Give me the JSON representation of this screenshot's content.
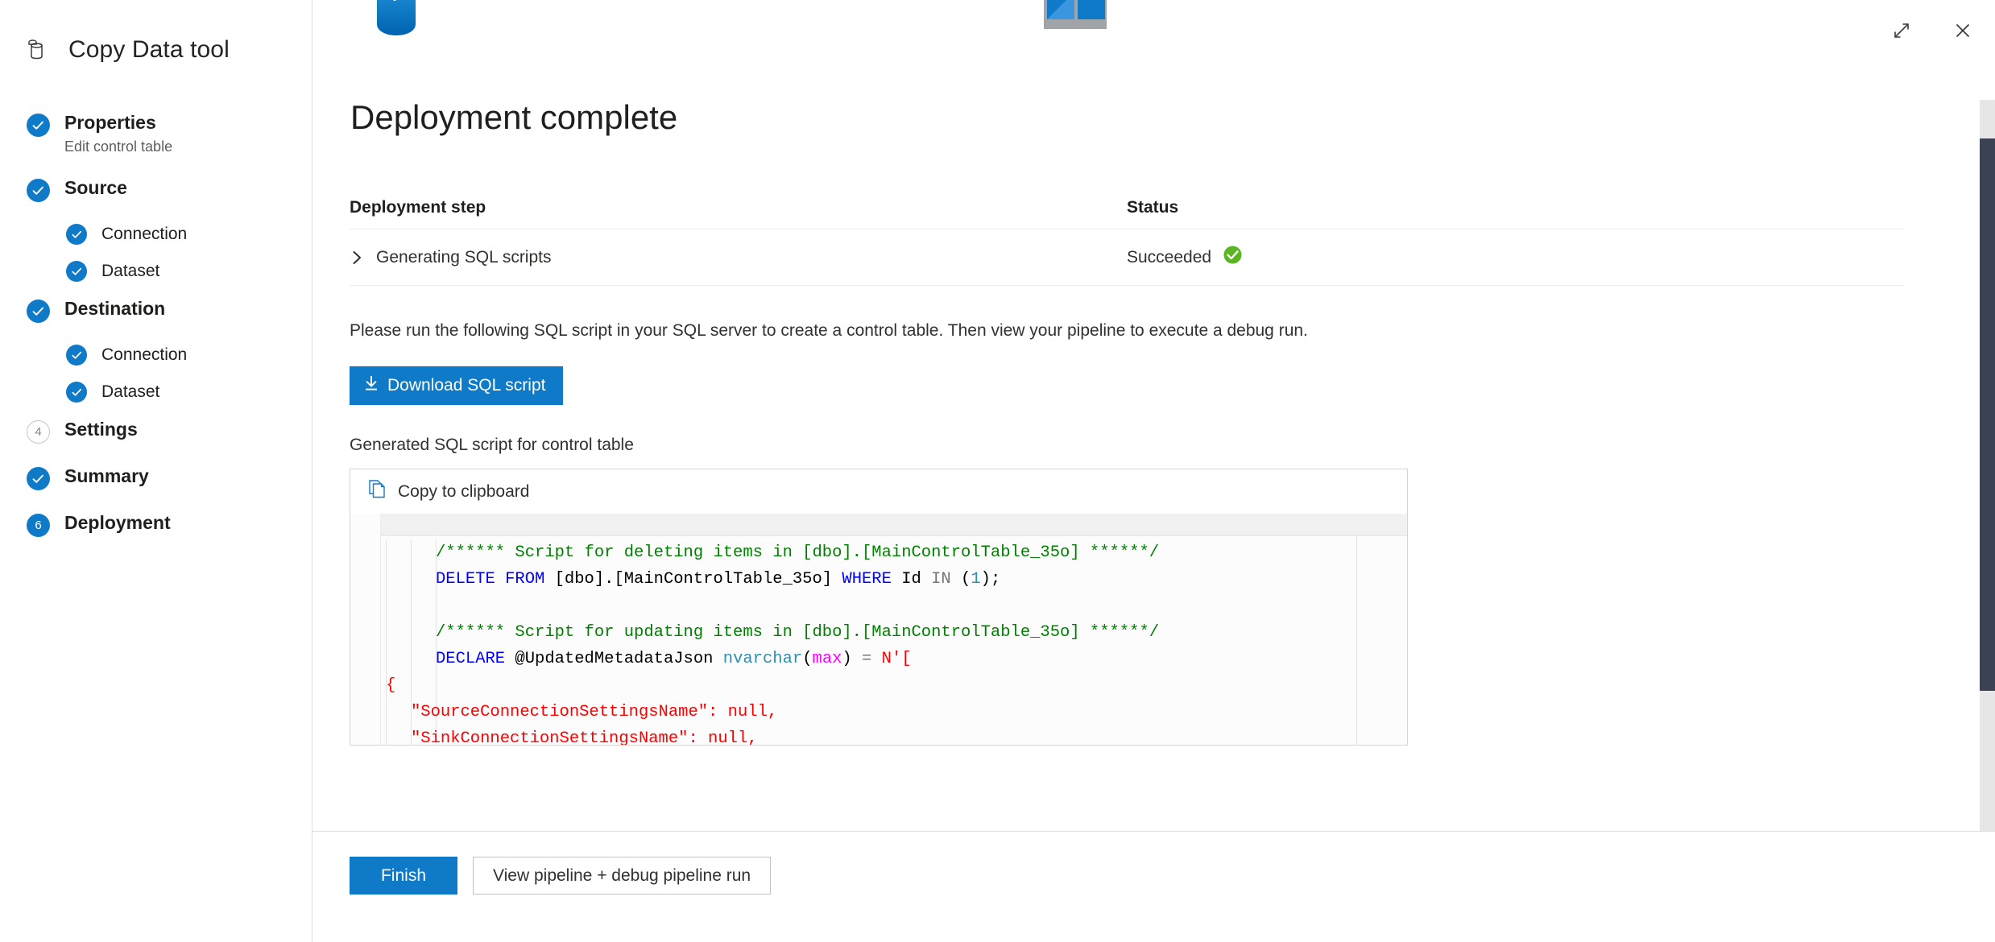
{
  "app": {
    "title": "Copy Data tool",
    "brand_icon": "database-icon"
  },
  "window_controls": {
    "maximize_icon": "expand-diagonal-icon",
    "close_icon": "close-icon"
  },
  "sidebar": {
    "items": [
      {
        "label": "Properties",
        "sub": "Edit control table",
        "state": "done",
        "marker": "check",
        "level": "top"
      },
      {
        "label": "Source",
        "sub": "",
        "state": "done",
        "marker": "check",
        "level": "top"
      },
      {
        "label": "Connection",
        "sub": "",
        "state": "done",
        "marker": "check",
        "level": "sub"
      },
      {
        "label": "Dataset",
        "sub": "",
        "state": "done",
        "marker": "check",
        "level": "sub"
      },
      {
        "label": "Destination",
        "sub": "",
        "state": "done",
        "marker": "check",
        "level": "top"
      },
      {
        "label": "Connection",
        "sub": "",
        "state": "done",
        "marker": "check",
        "level": "sub"
      },
      {
        "label": "Dataset",
        "sub": "",
        "state": "done",
        "marker": "check",
        "level": "sub"
      },
      {
        "label": "Settings",
        "sub": "",
        "state": "pending",
        "marker": "4",
        "level": "top"
      },
      {
        "label": "Summary",
        "sub": "",
        "state": "done",
        "marker": "check",
        "level": "top"
      },
      {
        "label": "Deployment",
        "sub": "",
        "state": "current",
        "marker": "6",
        "level": "top"
      }
    ]
  },
  "main": {
    "page_title": "Deployment complete",
    "service_icons": {
      "left": "azure-sql-database-icon",
      "right": "azure-synapse-icon"
    },
    "table": {
      "headers": {
        "step": "Deployment step",
        "status": "Status"
      },
      "rows": [
        {
          "expander_icon": "chevron-right-icon",
          "step": "Generating SQL scripts",
          "status": "Succeeded",
          "status_icon": "check-circle-green-icon"
        }
      ]
    },
    "instruction": "Please run the following SQL script in your SQL server to create a control table. Then view your pipeline to execute a debug run.",
    "download_button": {
      "label": "Download SQL script",
      "icon": "download-arrow-icon"
    },
    "generated_label": "Generated SQL script for control table",
    "code_block": {
      "copy_label": "Copy to clipboard",
      "copy_icon": "copy-pages-icon",
      "lines": [
        {
          "indent": 2,
          "tokens": [
            {
              "t": "/****** Script for deleting items in [dbo].[MainControlTable_35o] ******/",
              "c": "comment"
            }
          ]
        },
        {
          "indent": 2,
          "tokens": [
            {
              "t": "DELETE FROM",
              "c": "kw"
            },
            {
              "t": " [dbo].[MainControlTable_35o] ",
              "c": "plain"
            },
            {
              "t": "WHERE",
              "c": "kw"
            },
            {
              "t": " Id ",
              "c": "plain"
            },
            {
              "t": "IN",
              "c": "gray"
            },
            {
              "t": " (",
              "c": "plain"
            },
            {
              "t": "1",
              "c": "kw2"
            },
            {
              "t": ");",
              "c": "plain"
            }
          ]
        },
        {
          "indent": 2,
          "tokens": [
            {
              "t": "",
              "c": "plain"
            }
          ]
        },
        {
          "indent": 2,
          "tokens": [
            {
              "t": "/****** Script for updating items in [dbo].[MainControlTable_35o] ******/",
              "c": "comment"
            }
          ]
        },
        {
          "indent": 2,
          "tokens": [
            {
              "t": "DECLARE",
              "c": "kw"
            },
            {
              "t": " @UpdatedMetadataJson ",
              "c": "plain"
            },
            {
              "t": "nvarchar",
              "c": "type"
            },
            {
              "t": "(",
              "c": "plain"
            },
            {
              "t": "max",
              "c": "fn"
            },
            {
              "t": ") ",
              "c": "plain"
            },
            {
              "t": "=",
              "c": "gray"
            },
            {
              "t": " ",
              "c": "plain"
            },
            {
              "t": "N'[",
              "c": "str"
            }
          ]
        },
        {
          "indent": 0,
          "tokens": [
            {
              "t": "{",
              "c": "str"
            }
          ]
        },
        {
          "indent": 1,
          "tokens": [
            {
              "t": "\"SourceConnectionSettingsName\": null,",
              "c": "str"
            }
          ]
        },
        {
          "indent": 1,
          "tokens": [
            {
              "t": "\"SinkConnectionSettingsName\": null,",
              "c": "str"
            }
          ]
        }
      ]
    }
  },
  "footer": {
    "primary_button": "Finish",
    "secondary_button": "View pipeline + debug pipeline run"
  },
  "colors": {
    "accent": "#0f7ac8",
    "success": "#5bb522",
    "scrollbar_thumb": "#3b4252",
    "scrollbar_track": "#e6e6e6",
    "divider": "#e1dfdd"
  }
}
